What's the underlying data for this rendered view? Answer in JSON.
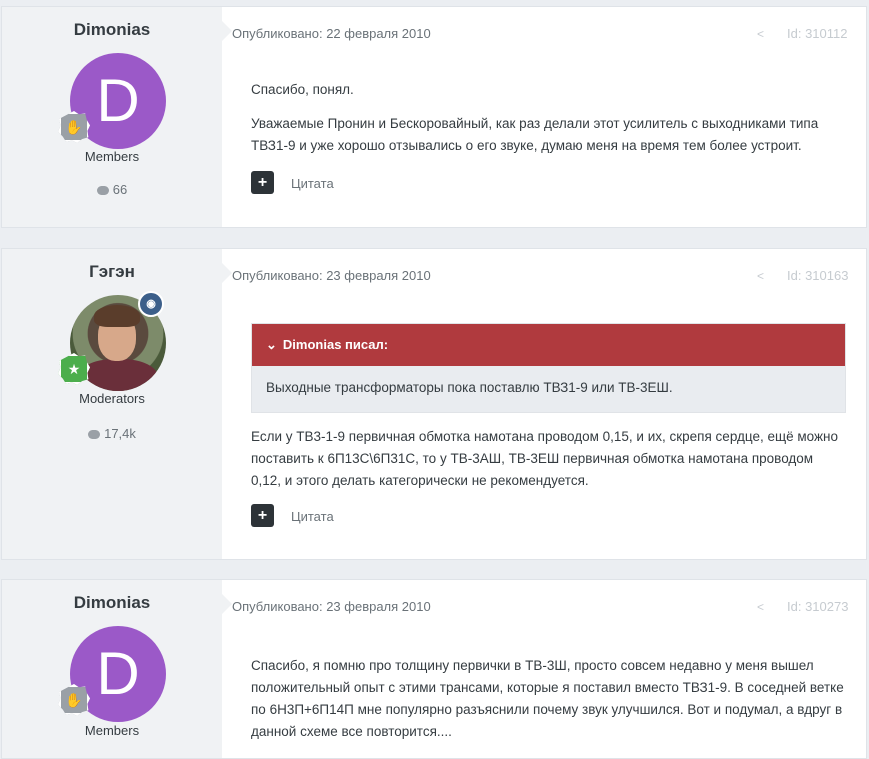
{
  "posts": [
    {
      "author": "Dimonias",
      "avatar_letter": "D",
      "group": "Members",
      "post_count": "66",
      "posted": "Опубликовано: 22 февраля 2010",
      "id_label": "Id: 310112",
      "paragraphs": [
        "Спасибо, понял.",
        "Уважаемые Пронин и Бескоровайный, как раз делали этот усилитель с выходниками типа ТВЗ1-9 и уже хорошо отзывались о его звуке, думаю меня на время тем более устроит."
      ],
      "quote_action": "Цитата"
    },
    {
      "author": "Гэгэн",
      "group": "Moderators",
      "post_count": "17,4k",
      "posted": "Опубликовано: 23 февраля 2010",
      "id_label": "Id: 310163",
      "quote": {
        "header": "Dimonias писал:",
        "text": "Выходные трансформаторы пока поставлю ТВЗ1-9 или ТВ-3ЕШ."
      },
      "paragraphs": [
        "Если у ТВ3-1-9 первичная обмотка намотана проводом 0,15, и их, скрепя сердце, ещё можно поставить к 6П13С\\6П31С, то у ТВ-3АШ, ТВ-3ЕШ первичная обмотка намотана проводом 0,12, и этого делать категорически не рекомендуется."
      ],
      "quote_action": "Цитата"
    },
    {
      "author": "Dimonias",
      "avatar_letter": "D",
      "group": "Members",
      "posted": "Опубликовано: 23 февраля 2010",
      "id_label": "Id: 310273",
      "paragraphs": [
        "Спасибо, я помню про толщину первички в ТВ-3Ш, просто совсем недавно у меня вышел положительный опыт с этими трансами, которые я поставил вместо ТВЗ1-9. В соседней ветке по 6Н3П+6П14П мне популярно разъяснили почему звук улучшился. Вот и подумал, а вдруг в данной схеме все повторится...."
      ]
    }
  ],
  "colors": {
    "avatar_purple": "#9b59c8",
    "quote_header": "#b03a3e",
    "page_bg": "#ebeef2"
  }
}
